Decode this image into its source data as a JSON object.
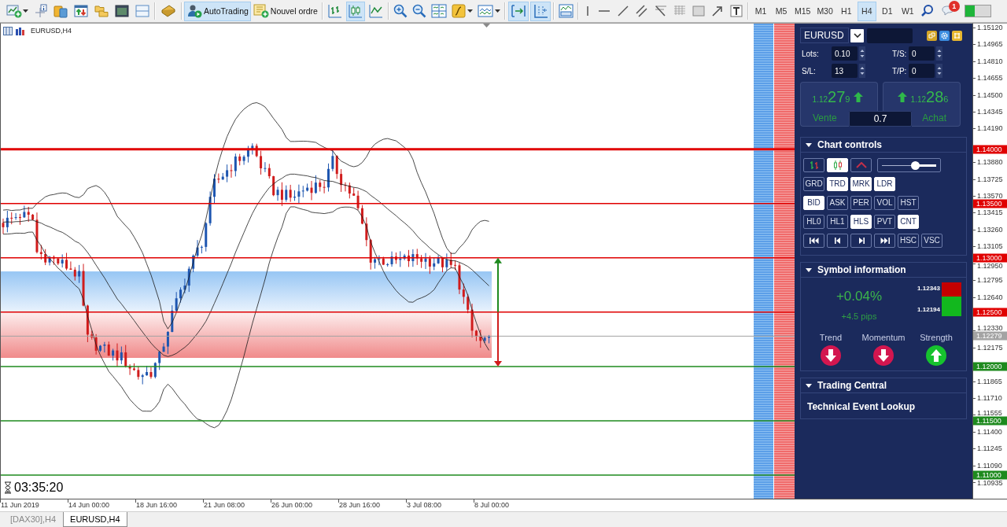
{
  "toolbar": {
    "buttons": [
      {
        "label": "AutoTrading",
        "kind": "autotrading",
        "on": true
      },
      {
        "label": "Nouvel ordre",
        "kind": "order",
        "on": false
      }
    ],
    "chart_types": [
      {
        "kind": "bars",
        "selected": false
      },
      {
        "kind": "candles",
        "selected": true
      },
      {
        "kind": "line",
        "selected": false
      }
    ],
    "toggles": [
      {
        "kind": "autoscroll",
        "on": true
      },
      {
        "kind": "shift",
        "on": true
      }
    ],
    "timeframes": [
      {
        "label": "M1",
        "selected": false
      },
      {
        "label": "M5",
        "selected": false
      },
      {
        "label": "M15",
        "selected": false
      },
      {
        "label": "M30",
        "selected": false
      },
      {
        "label": "H1",
        "selected": false
      },
      {
        "label": "H4",
        "selected": true
      },
      {
        "label": "D1",
        "selected": false
      },
      {
        "label": "W1",
        "selected": false
      }
    ],
    "notification_count": "1"
  },
  "chart": {
    "title": "EURUSD,H4",
    "levels": [
      {
        "price": "1.14000",
        "kind": "major",
        "color": "#e00000"
      },
      {
        "price": "1.13500",
        "kind": "level",
        "color": "#e00000"
      },
      {
        "price": "1.13000",
        "kind": "level",
        "color": "#e00000"
      },
      {
        "price": "1.12500",
        "kind": "level",
        "color": "#e00000"
      },
      {
        "price": "1.12279",
        "kind": "bid",
        "color": "#a3a3a3"
      },
      {
        "price": "1.12000",
        "kind": "level",
        "color": "#1e8a1e"
      },
      {
        "price": "1.11500",
        "kind": "level",
        "color": "#1e8a1e"
      },
      {
        "price": "1.11000",
        "kind": "level",
        "color": "#1e8a1e"
      }
    ],
    "timer": "03:35:20",
    "price_axis": [
      "1.15120",
      "1.14965",
      "1.14810",
      "1.14655",
      "1.14500",
      "1.14345",
      "1.14190",
      "1.13880",
      "1.13725",
      "1.13570",
      "1.13415",
      "1.13260",
      "1.13105",
      "1.12950",
      "1.12795",
      "1.12640",
      "1.12330",
      "1.12175",
      "1.11865",
      "1.11710",
      "1.11555",
      "1.11400",
      "1.11245",
      "1.11090",
      "1.10935"
    ],
    "time_axis": [
      "11 Jun 2019",
      "14 Jun 00:00",
      "18 Jun 16:00",
      "21 Jun 08:00",
      "26 Jun 00:00",
      "28 Jun 16:00",
      "3 Jul 08:00",
      "8 Jul 00:00"
    ]
  },
  "trade_panel": {
    "symbol": "EURUSD",
    "fields": [
      {
        "label": "Lots:",
        "value": "0.10"
      },
      {
        "label": "T/S:",
        "value": "0"
      },
      {
        "label": "S/L:",
        "value": "13"
      },
      {
        "label": "T/P:",
        "value": "0"
      }
    ],
    "quotes": [
      {
        "label": "Vente",
        "prefix": "1.12",
        "pips": "27",
        "fraction": "9",
        "rising": true
      },
      {
        "label": "Achat",
        "prefix": "1.12",
        "pips": "28",
        "fraction": "6",
        "rising": true
      }
    ],
    "volume": "0.7",
    "sections": [
      {
        "title": "Chart controls",
        "kind": "controls",
        "expanded": true,
        "rows": [
          {
            "buttons": [
              {
                "kind": "bars",
                "selected": false
              },
              {
                "kind": "candles",
                "selected": true
              },
              {
                "kind": "line",
                "selected": false
              }
            ],
            "slider": {
              "level": 0.6
            }
          },
          {
            "buttons": [
              {
                "kind": "text",
                "label": "GRD",
                "selected": false
              },
              {
                "kind": "text",
                "label": "TRD",
                "selected": true
              },
              {
                "kind": "text",
                "label": "MRK",
                "selected": true
              },
              {
                "kind": "text",
                "label": "LDR",
                "selected": true
              }
            ]
          },
          {
            "buttons": [
              {
                "kind": "text",
                "label": "BID",
                "selected": true
              },
              {
                "kind": "text",
                "label": "ASK",
                "selected": false
              },
              {
                "kind": "text",
                "label": "PER",
                "selected": false
              },
              {
                "kind": "text",
                "label": "VOL",
                "selected": false
              },
              {
                "kind": "text",
                "label": "HST",
                "selected": false
              }
            ]
          },
          {
            "buttons": [
              {
                "kind": "text",
                "label": "HL0",
                "selected": false
              },
              {
                "kind": "text",
                "label": "HL1",
                "selected": false
              },
              {
                "kind": "text",
                "label": "HLS",
                "selected": true
              },
              {
                "kind": "text",
                "label": "PVT",
                "selected": false
              },
              {
                "kind": "text",
                "label": "CNT",
                "selected": true
              }
            ]
          },
          {
            "buttons": [
              {
                "kind": "first",
                "selected": false
              },
              {
                "kind": "prev",
                "selected": false
              },
              {
                "kind": "next",
                "selected": false
              },
              {
                "kind": "last",
                "selected": false
              },
              {
                "kind": "text",
                "label": "HSC",
                "selected": false
              },
              {
                "kind": "text",
                "label": "VSC",
                "selected": false
              }
            ]
          }
        ]
      },
      {
        "title": "Symbol information",
        "kind": "symbol",
        "expanded": true,
        "change": "+0.04%",
        "pips": "+4.5 pips",
        "high": "1.12343",
        "low": "1.12194",
        "signals": [
          {
            "label": "Trend",
            "rising": false
          },
          {
            "label": "Momentum",
            "rising": false
          },
          {
            "label": "Strength",
            "rising": true
          }
        ]
      },
      {
        "title": "Trading Central",
        "kind": "links",
        "expanded": true,
        "items": [
          "Technical Event Lookup"
        ]
      }
    ]
  },
  "tabs": [
    {
      "label": "[DAX30],H4",
      "selected": false
    },
    {
      "label": "EURUSD,H4",
      "selected": true
    }
  ]
}
